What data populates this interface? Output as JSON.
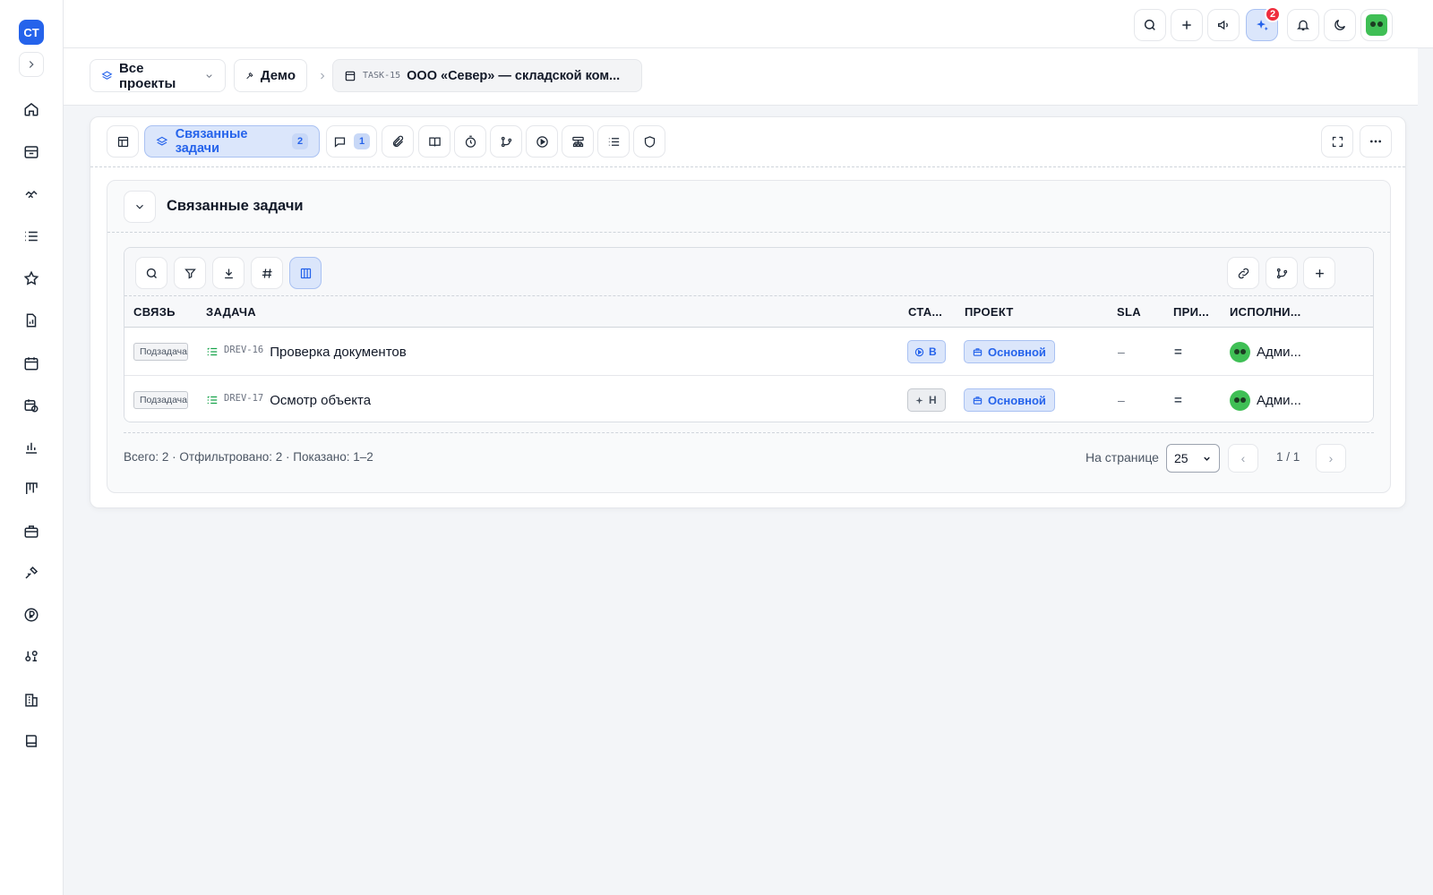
{
  "rail": {
    "logo": "CT",
    "items": [
      "home-icon",
      "inbox-icon",
      "handshake-icon",
      "list-icon",
      "star-icon",
      "file-chart-icon",
      "calendar-icon",
      "calendar-clock-icon",
      "bar-chart-icon",
      "kanban-icon",
      "briefcase-icon",
      "tools-icon",
      "ruble-icon",
      "users-gear-icon",
      "building-icon",
      "book-icon"
    ]
  },
  "topbar": {
    "notification_badge": "2",
    "buttons": [
      "search-icon",
      "plus-icon",
      "megaphone-icon",
      "sparkles-icon",
      "bell-icon",
      "moon-icon"
    ]
  },
  "breadcrumb": {
    "projects_label": "Все проекты",
    "demo_label": "Демо",
    "task_code": "TASK-15",
    "task_title": "ООО «Север» — складской ком..."
  },
  "tabs": {
    "related_label": "Связанные задачи",
    "related_count": "2",
    "comments_count": "1"
  },
  "section": {
    "title": "Связанные задачи"
  },
  "table": {
    "columns": [
      "Связь",
      "Задача",
      "Ста...",
      "Проект",
      "SLA",
      "При...",
      "Исполни..."
    ],
    "rows": [
      {
        "relation": "Подзадача",
        "code": "DREV-16",
        "title": "Проверка документов",
        "status": "В",
        "project": "Основной",
        "sla": "–",
        "priority": "=",
        "assignee": "Адми..."
      },
      {
        "relation": "Подзадача",
        "code": "DREV-17",
        "title": "Осмотр объекта",
        "status": "Н",
        "project": "Основной",
        "sla": "–",
        "priority": "=",
        "assignee": "Адми..."
      }
    ]
  },
  "footer": {
    "summary": "Всего: 2 · Отфильтровано: 2 · Показано: 1–2",
    "per_page_label": "На странице",
    "per_page_value": "25",
    "prev": "‹",
    "next": "›",
    "page_info": "1 / 1"
  },
  "colors": {
    "accent": "#2563eb",
    "accent_bg": "#dbe6fb",
    "badge_red": "#ef2d3d",
    "avatar_green": "#3fbf55"
  }
}
